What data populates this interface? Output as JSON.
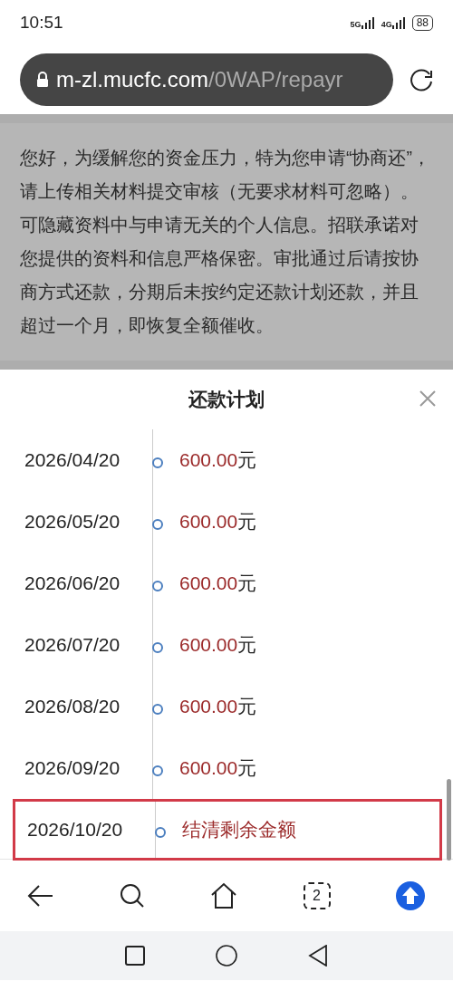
{
  "status_bar": {
    "time": "10:51",
    "signals": [
      "5G",
      "4G"
    ],
    "battery": "88"
  },
  "browser": {
    "url_host": "m-zl.mucfc.com",
    "url_path": "/0WAP/repayr"
  },
  "page": {
    "notice": "您好，为缓解您的资金压力，特为您申请“协商还”，请上传相关材料提交审核（无要求材料可忽略）。可隐藏资料中与申请无关的个人信息。招联承诺对您提供的资料和信息严格保密。审批通过后请按协商方式还款，分期后未按约定还款计划还款，并且超过一个月，即恢复全额催收。"
  },
  "sheet": {
    "title": "还款计划",
    "plan": [
      {
        "date": "2026/04/20",
        "amount": "600.00",
        "unit": "元",
        "highlighted": false
      },
      {
        "date": "2026/05/20",
        "amount": "600.00",
        "unit": "元",
        "highlighted": false
      },
      {
        "date": "2026/06/20",
        "amount": "600.00",
        "unit": "元",
        "highlighted": false
      },
      {
        "date": "2026/07/20",
        "amount": "600.00",
        "unit": "元",
        "highlighted": false
      },
      {
        "date": "2026/08/20",
        "amount": "600.00",
        "unit": "元",
        "highlighted": false
      },
      {
        "date": "2026/09/20",
        "amount": "600.00",
        "unit": "元",
        "highlighted": false
      },
      {
        "date": "2026/10/20",
        "amount": "结清剩余金额",
        "highlighted": true
      }
    ]
  },
  "toolbar": {
    "tab_count": "2"
  }
}
